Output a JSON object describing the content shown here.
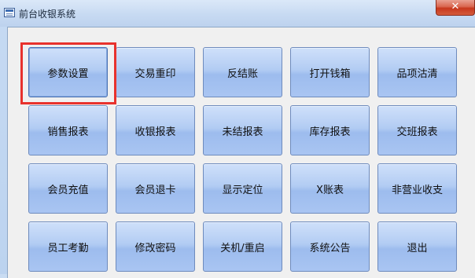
{
  "window": {
    "title": "前台收银系统",
    "close_label": "✕"
  },
  "buttons": [
    [
      "参数设置",
      "交易重印",
      "反结账",
      "打开钱箱",
      "品项沽清"
    ],
    [
      "销售报表",
      "收银报表",
      "未结报表",
      "库存报表",
      "交班报表"
    ],
    [
      "会员充值",
      "会员退卡",
      "显示定位",
      "X账表",
      "非营业收支"
    ],
    [
      "员工考勤",
      "修改密码",
      "关机/重启",
      "系统公告",
      "退出"
    ]
  ],
  "highlighted_button": "参数设置",
  "colors": {
    "highlight_border": "#e8322d",
    "button_face": "#a9c5f2",
    "window_frame": "#c6daf3"
  },
  "icons": {
    "app": "app-window-icon",
    "close": "close-icon"
  }
}
